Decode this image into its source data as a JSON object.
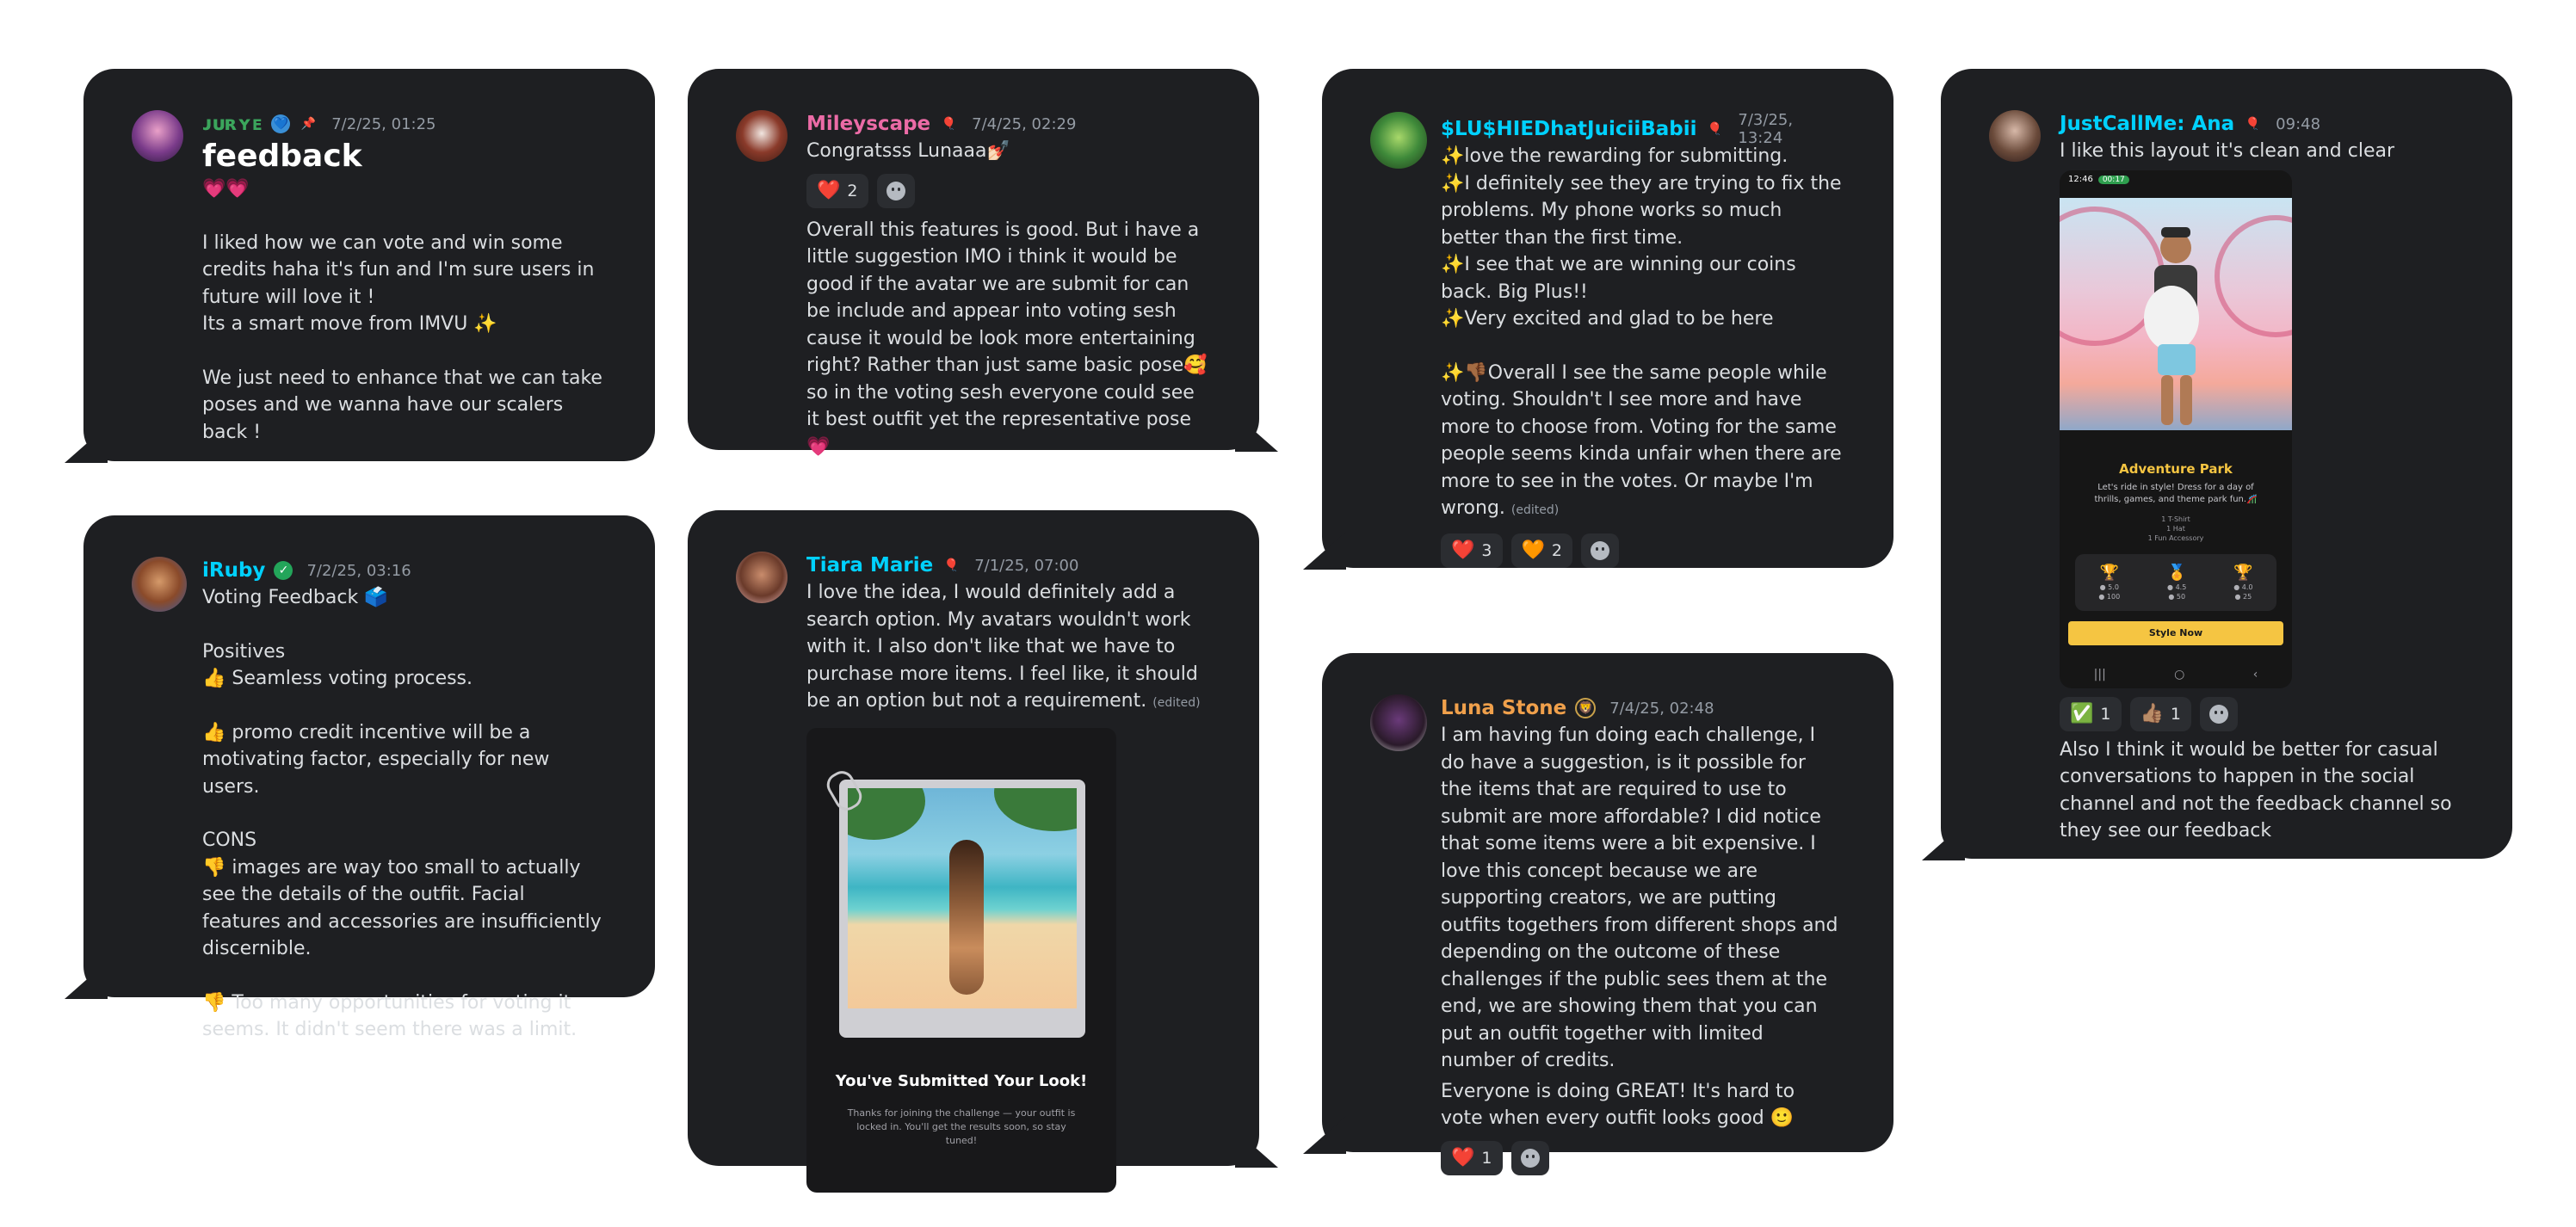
{
  "cards": {
    "c1": {
      "username": "ᴊᴜʀʏᴇ",
      "username_color": "#3ba55c",
      "timestamp": "7/2/25, 01:25",
      "title": "feedback",
      "hearts": "💗💗",
      "p1": "I liked how we can vote and win some credits haha it's fun and I'm sure users in future will love it !",
      "p2": "Its a smart move from IMVU ✨",
      "p3": "We just need to enhance that we can take poses and we wanna have our scalers back !"
    },
    "c2": {
      "username": "Mileyscape",
      "username_color": "#eb6ba6",
      "timestamp": "7/4/25, 02:29",
      "line1": "Congratsss Lunaaa💅🏻",
      "reactions": [
        {
          "emoji": "❤️",
          "count": "2"
        }
      ],
      "body": "Overall this features is good. But i have a little suggestion IMO i think it would be good if the avatar we are submit for can be include and appear into voting sesh cause it would be look more entertaining right? Rather than just same basic pose🥰 so in the voting sesh everyone could see it best outfit yet the representative pose💗"
    },
    "c3": {
      "username": "$LU$HIEDhatJuiciiBabii",
      "username_color": "#00d1ff",
      "timestamp": "7/3/25, 13:24",
      "l1": "✨love the rewarding for submitting.",
      "l2": "✨I definitely see they are trying to fix the problems. My phone works so much better than the first time.",
      "l3": "✨I see that we are winning our coins back. Big Plus!!",
      "l4": "✨Very excited and glad to be here",
      "l5": "✨👎🏾Overall I see the same people while voting. Shouldn't I see more and have more to choose from. Voting for the same people seems kinda unfair when there are more to see in the votes. Or maybe I'm wrong.",
      "edited": "(edited)",
      "reactions": [
        {
          "emoji": "❤️",
          "count": "3"
        },
        {
          "emoji": "🧡",
          "count": "2"
        }
      ]
    },
    "c4": {
      "username": "JustCallMe: Ana",
      "username_color": "#00d1ff",
      "timestamp": "09:48",
      "line1": "I like this layout it's clean and clear",
      "phone": {
        "time": "12:46",
        "call": "00:17",
        "card_title": "Adventure Park",
        "card_desc": "Let's ride in style! Dress for a day of thrills, games, and theme park fun.🎢",
        "list": [
          "1 T-Shirt",
          "1 Hat",
          "1 Fun Accessory"
        ],
        "tiers": [
          {
            "icon": "🏆",
            "a": "● 5.0",
            "b": "● 100"
          },
          {
            "icon": "🏅",
            "a": "● 4.5",
            "b": "● 50"
          },
          {
            "icon": "🏆",
            "a": "● 4.0",
            "b": "● 25"
          }
        ],
        "button": "Style Now",
        "nav": [
          "|||",
          "○",
          "‹"
        ]
      },
      "reactions": [
        {
          "emoji": "✅",
          "count": "1"
        },
        {
          "emoji": "👍🏽",
          "count": "1"
        }
      ],
      "body": "Also I think it would be better for casual conversations to happen in the social channel and not the feedback channel so they see our feedback"
    },
    "c5": {
      "username": "iRuby",
      "username_color": "#00d1ff",
      "timestamp": "7/2/25, 03:16",
      "line1": "Voting Feedback 🗳️",
      "pos_h": "Positives",
      "pos1": "👍 Seamless voting process.",
      "pos2": "👍 promo credit incentive will be a motivating factor, especially for new users.",
      "cons_h": "CONS",
      "con1": "👎 images are way too small to actually see the details of the outfit. Facial features and accessories are insufficiently discernible.",
      "con2": "👎 Too many opportunities for voting it seems. It didn't seem there was a limit."
    },
    "c6": {
      "username": "Tiara Marie",
      "username_color": "#00d1ff",
      "timestamp": "7/1/25, 07:00",
      "body": "I love the idea, I would definitely add a search option. My avatars wouldn't work with it. I also don't like that we have to purchase more items. I feel like, it should be an option but not a requirement.",
      "edited": "(edited)",
      "img_title": "You've Submitted Your Look!",
      "img_sub": "Thanks for joining the challenge — your outfit is locked in. You'll get the results soon, so stay tuned!"
    },
    "c7": {
      "username": "Luna Stone",
      "username_color": "#f0a04b",
      "timestamp": "7/4/25, 02:48",
      "body": "I am having fun doing each challenge, I do have a suggestion, is it possible for the items that are required to use to submit are more affordable? I did notice that some items were a bit expensive. I love this concept because we are supporting creators, we are putting outfits togethers from different shops and depending on the outcome of these challenges if the public sees them at the end, we are showing them that you can put an outfit together with limited number of credits.",
      "body2": "Everyone is doing GREAT! It's hard to vote when every outfit looks good 🙂",
      "reactions": [
        {
          "emoji": "❤️",
          "count": "1"
        }
      ]
    }
  }
}
